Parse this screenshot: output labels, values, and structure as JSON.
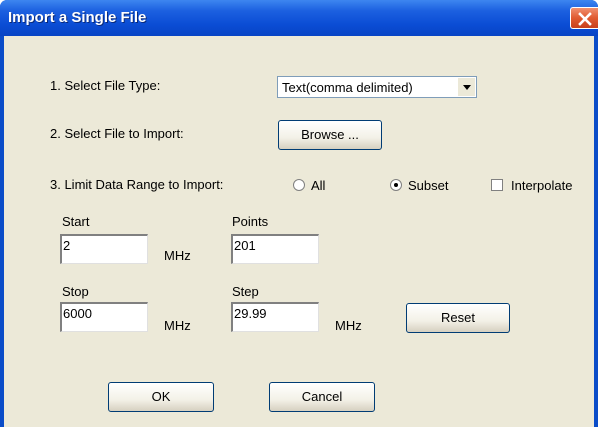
{
  "window": {
    "title": "Import a Single File"
  },
  "steps": {
    "file_type_label": "1. Select File Type:",
    "select_file_label": "2. Select File to Import:",
    "range_label": "3. Limit Data Range to Import:"
  },
  "file_type": {
    "selected": "Text(comma delimited)"
  },
  "browse_label": "Browse ...",
  "range_options": {
    "all_label": "All",
    "all_selected": false,
    "subset_label": "Subset",
    "subset_selected": true,
    "interpolate_label": "Interpolate",
    "interpolate_checked": false
  },
  "fields": {
    "start": {
      "label": "Start",
      "value": "2",
      "unit": "MHz"
    },
    "points": {
      "label": "Points",
      "value": "201"
    },
    "stop": {
      "label": "Stop",
      "value": "6000",
      "unit": "MHz"
    },
    "step": {
      "label": "Step",
      "value": "29.99",
      "unit": "MHz"
    }
  },
  "buttons": {
    "reset": "Reset",
    "ok": "OK",
    "cancel": "Cancel"
  },
  "icons": {
    "close": "close-icon",
    "dropdown": "chevron-down-icon"
  },
  "colors": {
    "titlebar": "#0a4cd4",
    "close_button": "#e05a30",
    "client_bg": "#ece9d8"
  }
}
